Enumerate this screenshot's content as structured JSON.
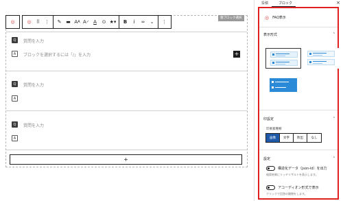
{
  "editor": {
    "outline_tag": "親ブロック選択",
    "toolbar": {
      "block_type_icon": "faq-block-icon",
      "buttons": [
        "faq-icon",
        "drag-handle-icon",
        "move-arrows-icon",
        "highlighter-icon",
        "inline-code-icon",
        "font-size-icon",
        "text-color-icon",
        "underline-icon",
        "inline-image-icon",
        "star-icon",
        "bold-icon",
        "italic-icon",
        "link-icon",
        "chevron-down-icon",
        "more-options-icon"
      ],
      "bold_label": "B",
      "italic_label": "i",
      "font_label": "A",
      "underline_label": "A"
    },
    "rows": [
      {
        "q_mark": "Q",
        "question_placeholder": "質問を入力",
        "a_mark": "A",
        "answer_placeholder": "ブロックを選択するには「/」を入力"
      },
      {
        "q_mark": "Q",
        "question_placeholder": "質問を入力",
        "a_mark": "A"
      },
      {
        "q_mark": "Q",
        "question_placeholder": "質問を入力",
        "a_mark": "A"
      }
    ],
    "inline_add": "+",
    "add_button": "+"
  },
  "sidebar": {
    "tabs": [
      "投稿",
      "ブロック"
    ],
    "close": "×",
    "block": {
      "icon": "faq-block-icon",
      "title": "FAQ表示"
    },
    "style_panel": {
      "title": "表示形式"
    },
    "settings_panel": {
      "title": "印設定",
      "sub_label": "印要素種類",
      "options": [
        "画像",
        "文字",
        "吹出",
        "なし"
      ],
      "selected": "画像"
    },
    "config_panel": {
      "title": "設定",
      "toggles": [
        {
          "label": "構造化データ（json-ld）を出力",
          "help": "検索結果にリッチリザルトを表示します。",
          "on": false
        },
        {
          "label": "アコーディオン形式で表示",
          "help": "クリックで回答の開閉をします。",
          "on": false
        }
      ]
    },
    "accent_color": "#e21f1f",
    "style_color": "#2b8ad8"
  }
}
